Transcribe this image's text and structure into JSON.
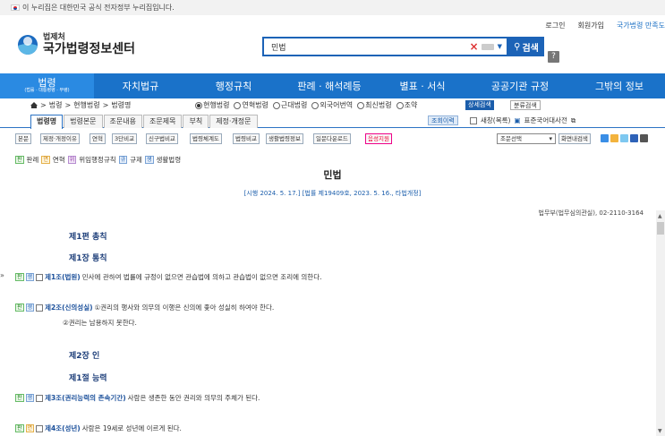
{
  "gov_banner": "이 누리집은 대한민국 공식 전자정부 누리집입니다.",
  "toplinks": [
    "로그인",
    "회원가입",
    "국가법령 만족도"
  ],
  "logo": {
    "small": "법제처",
    "big": "국가법령정보센터"
  },
  "search": {
    "value": "민법",
    "button": "검색"
  },
  "help": "?",
  "nav": [
    {
      "label": "법령",
      "sub": "(법률 · 대통령령 · 부령)"
    },
    {
      "label": "자치법규"
    },
    {
      "label": "행정규칙"
    },
    {
      "label": "판례 · 해석례등"
    },
    {
      "label": "별표 · 서식"
    },
    {
      "label": "공공기관 규정"
    },
    {
      "label": "그밖의 정보"
    }
  ],
  "breadcrumb": [
    "법령",
    "현행법령",
    "법령명"
  ],
  "radios": [
    {
      "label": "현행법령",
      "checked": true
    },
    {
      "label": "연혁법령",
      "checked": false
    },
    {
      "label": "근대법령",
      "checked": false
    },
    {
      "label": "외국어번역",
      "checked": false
    },
    {
      "label": "최신법령",
      "checked": false
    },
    {
      "label": "조약",
      "checked": false
    }
  ],
  "adv_search": "상세검색",
  "class_search": "분류검색",
  "tabs": [
    "법령명",
    "법령본문",
    "조문내용",
    "조문제목",
    "부칙",
    "제정·개정문"
  ],
  "history_btn": "조회이력",
  "right_links": [
    "새창(목록)",
    "표준국어대사전"
  ],
  "toolbar": [
    "본문",
    "제정·개정이유",
    "연혁",
    "3단비교",
    "신구법비교",
    "법령체계도",
    "법령비교",
    "생활법령정보",
    "일문다운로드",
    "음성지원"
  ],
  "select": "조문선택",
  "screen_search": "화면내검색",
  "legend": [
    {
      "tag": "판",
      "label": "판례",
      "cls": "tg"
    },
    {
      "tag": "연",
      "label": "연혁",
      "cls": "ty"
    },
    {
      "tag": "위",
      "label": "위임행정규칙",
      "cls": "tp"
    },
    {
      "tag": "규",
      "label": "규제",
      "cls": "tb2"
    },
    {
      "tag": "생",
      "label": "생활법령",
      "cls": "tb2"
    }
  ],
  "law": {
    "title": "민법",
    "meta": "[시행 2024. 5. 17.] [법률 제19409호, 2023. 5. 16., 타법개정]",
    "ministry": "법무부(법무심의관실), 02-2110-3164"
  },
  "body": {
    "part1": "제1편 총칙",
    "ch1": "제1장 통칙",
    "art1": {
      "name": "제1조(법원)",
      "text": "민사에 관하여 법률에 규정이 없으면 관습법에 의하고 관습법이 없으면 조리에 의한다."
    },
    "art2": {
      "name": "제2조(신의성실)",
      "text": "①권리의 행사와 의무의 이행은 신의에 좇아 성실히 하여야 한다.",
      "para2": "②권리는 남용하지 못한다."
    },
    "ch2": "제2장 인",
    "sec1": "제1절 능력",
    "art3": {
      "name": "제3조(권리능력의 존속기간)",
      "text": "사람은 생존한 동안 권리와 의무의 주체가 된다."
    },
    "art4": {
      "name": "제4조(성년)",
      "text": "사람은 19세로 성년에 이르게 된다."
    }
  }
}
